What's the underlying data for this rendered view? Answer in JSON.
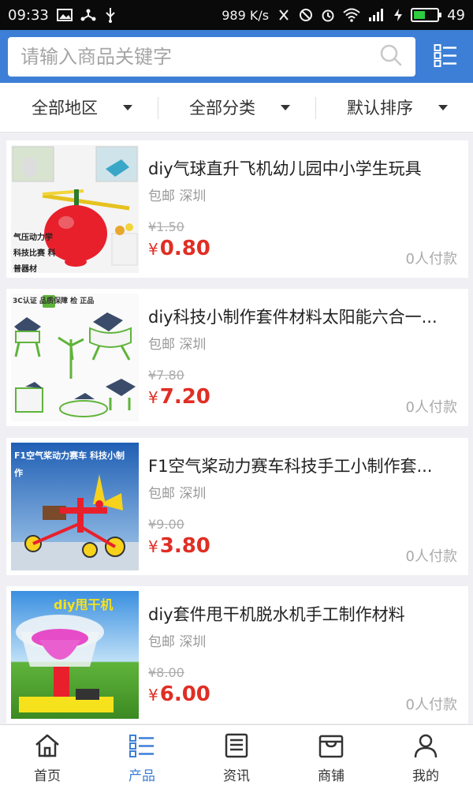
{
  "status_bar": {
    "time": "09:33",
    "speed": "989 K/s",
    "battery_level": "49"
  },
  "search": {
    "placeholder": "请输入商品关键字"
  },
  "filters": [
    {
      "label": "全部地区"
    },
    {
      "label": "全部分类"
    },
    {
      "label": "默认排序"
    }
  ],
  "products": [
    {
      "title": "diy气球直升飞机幼儿园中小学生玩具",
      "meta": "包邮 深圳",
      "old_price": "¥1.50",
      "yen": "¥",
      "price": "0.80",
      "sold": "0人付款",
      "thumb_caption": "气压动力学 科技比赛 科普器材"
    },
    {
      "title": "diy科技小制作套件材料太阳能六合一...",
      "meta": "包邮 深圳",
      "old_price": "¥7.80",
      "yen": "¥",
      "price": "7.20",
      "sold": "0人付款",
      "thumb_caption": "3C认证 品质保障 检 正品"
    },
    {
      "title": "F1空气桨动力赛车科技手工小制作套...",
      "meta": "包邮 深圳",
      "old_price": "¥9.00",
      "yen": "¥",
      "price": "3.80",
      "sold": "0人付款",
      "thumb_caption": "F1空气桨动力赛车 科技小制作"
    },
    {
      "title": "diy套件甩干机脱水机手工制作材料",
      "meta": "包邮 深圳",
      "old_price": "¥8.00",
      "yen": "¥",
      "price": "6.00",
      "sold": "0人付款",
      "thumb_caption": "diy甩干机"
    }
  ],
  "nav": [
    {
      "label": "首页",
      "icon": "home-icon"
    },
    {
      "label": "产品",
      "icon": "product-grid-icon",
      "active": true
    },
    {
      "label": "资讯",
      "icon": "news-icon"
    },
    {
      "label": "商铺",
      "icon": "store-icon"
    },
    {
      "label": "我的",
      "icon": "user-icon"
    }
  ],
  "colors": {
    "brand": "#3d7fd6",
    "price": "#e02e24",
    "status_bar": "#0a0a0a"
  }
}
